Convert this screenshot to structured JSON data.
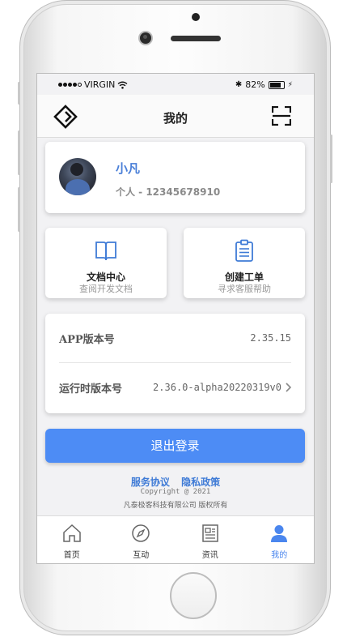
{
  "status_bar": {
    "carrier": "VIRGIN",
    "battery": "82%"
  },
  "navbar": {
    "title": "我的",
    "left_icon": "logo-diamond-icon",
    "right_icon": "scan-icon"
  },
  "profile": {
    "name": "小凡",
    "subtitle": "个人 - 12345678910"
  },
  "tiles": [
    {
      "title": "文档中心",
      "subtitle": "查阅开发文档",
      "icon": "book-icon"
    },
    {
      "title": "创建工单",
      "subtitle": "寻求客服帮助",
      "icon": "clipboard-icon"
    }
  ],
  "versions": [
    {
      "label": "APP版本号",
      "value": "2.35.15"
    },
    {
      "label": "运行时版本号",
      "value": "2.36.0-alpha20220319v0"
    }
  ],
  "logout_label": "退出登录",
  "links": {
    "service": "服务协议",
    "privacy": "隐私政策"
  },
  "copyright": "Copyright @ 2021",
  "company": "凡泰极客科技有限公司 版权所有",
  "tabs": [
    {
      "label": "首页",
      "icon": "home-icon"
    },
    {
      "label": "互动",
      "icon": "compass-icon"
    },
    {
      "label": "资讯",
      "icon": "news-icon"
    },
    {
      "label": "我的",
      "icon": "user-icon",
      "active": true
    }
  ],
  "colors": {
    "accent": "#4d8cf5",
    "link": "#3f7bd6",
    "name": "#4a7fd8"
  }
}
